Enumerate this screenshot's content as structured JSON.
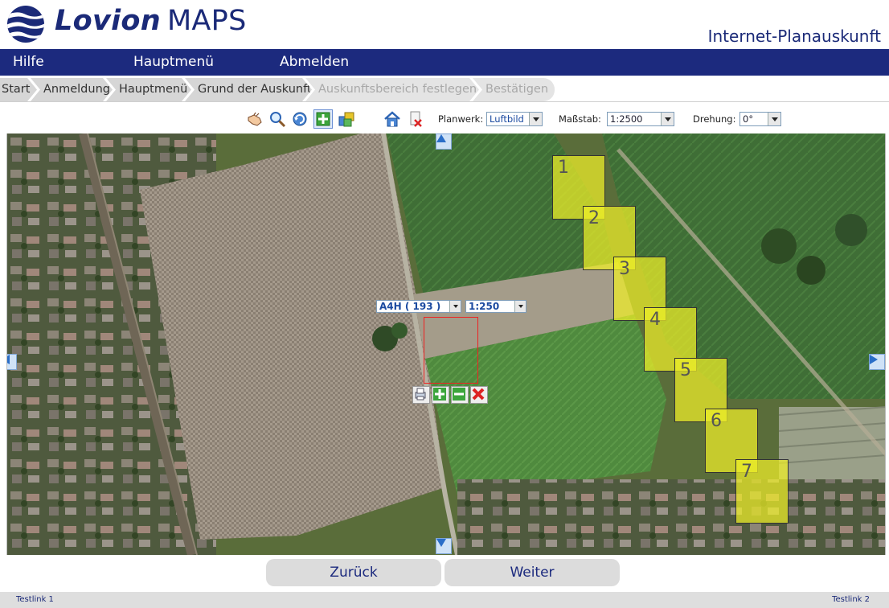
{
  "header": {
    "brand": "Lovion",
    "product": "MAPS",
    "subtitle": "Internet-Planauskunft"
  },
  "menu": {
    "items": [
      {
        "label": "Hilfe"
      },
      {
        "label": "Hauptmenü"
      },
      {
        "label": "Abmelden"
      }
    ]
  },
  "breadcrumb": {
    "steps": [
      {
        "label": "Start",
        "state": "done"
      },
      {
        "label": "Anmeldung",
        "state": "done"
      },
      {
        "label": "Hauptmenü",
        "state": "done"
      },
      {
        "label": "Grund der Auskunft",
        "state": "done"
      },
      {
        "label": "Auskunftsbereich festlegen",
        "state": "current"
      },
      {
        "label": "Bestätigen",
        "state": "todo"
      }
    ]
  },
  "toolbar": {
    "tools": [
      "pan-hand-icon",
      "zoom-magnifier-icon",
      "refresh-icon",
      "add-sheet-icon",
      "layers-icon",
      "home-icon",
      "delete-sheet-icon"
    ],
    "planwerk_label": "Planwerk:",
    "planwerk_value": "Luftbild",
    "massstab_label": "Maßstab:",
    "massstab_value": "1:2500",
    "drehung_label": "Drehung:",
    "drehung_value": "0°"
  },
  "map": {
    "sheets": [
      "1",
      "2",
      "3",
      "4",
      "5",
      "6",
      "7"
    ],
    "frame_format": "A4H ( 193 )",
    "frame_scale": "1:250",
    "frame_tools": [
      "print-icon",
      "add-icon",
      "minus-icon",
      "delete-icon"
    ],
    "colors": {
      "sheet_fill": "#f0f028",
      "frame_border": "#e22222"
    }
  },
  "buttons": {
    "back": "Zurück",
    "next": "Weiter"
  },
  "footer": {
    "link1": "Testlink 1",
    "link2": "Testlink 2"
  },
  "colors": {
    "brand_navy": "#1c2a7e",
    "crumb_bg": "#dedede"
  }
}
